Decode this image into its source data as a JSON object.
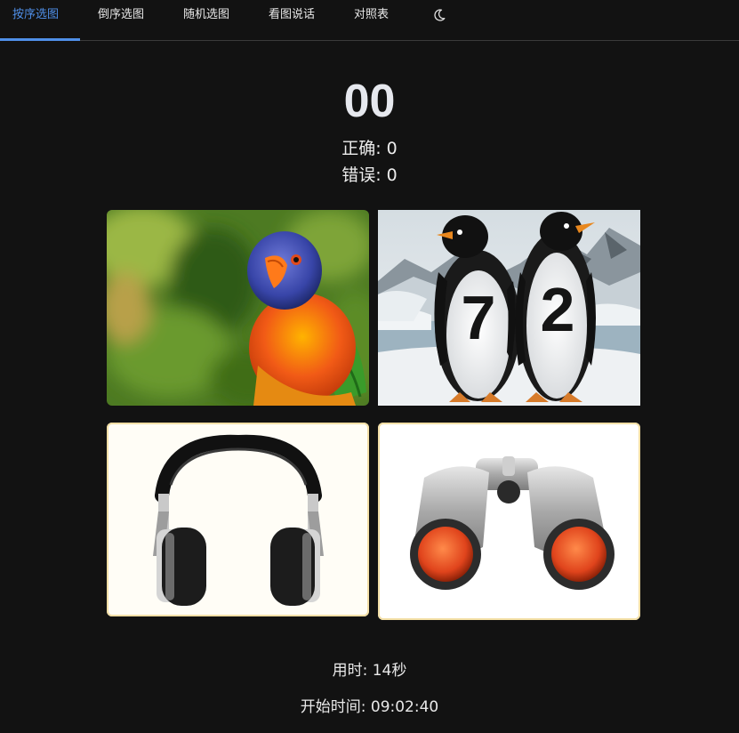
{
  "nav": {
    "tabs": [
      {
        "label": "按序选图",
        "active": true
      },
      {
        "label": "倒序选图",
        "active": false
      },
      {
        "label": "随机选图",
        "active": false
      },
      {
        "label": "看图说话",
        "active": false
      },
      {
        "label": "对照表",
        "active": false
      }
    ],
    "theme_icon": "moon-icon",
    "accent_color": "#4f8fe8"
  },
  "quiz": {
    "counter": "00",
    "correct_label": "正确: 0",
    "wrong_label": "错误: 0"
  },
  "images": [
    {
      "name": "parrot",
      "digits": ""
    },
    {
      "name": "penguins",
      "digits": "72"
    },
    {
      "name": "headphones",
      "digits": ""
    },
    {
      "name": "binoculars",
      "digits": ""
    }
  ],
  "penguins": {
    "left_digit": "7",
    "right_digit": "2"
  },
  "footer": {
    "elapsed": "用时: 14秒",
    "start_time": "开始时间: 09:02:40"
  }
}
